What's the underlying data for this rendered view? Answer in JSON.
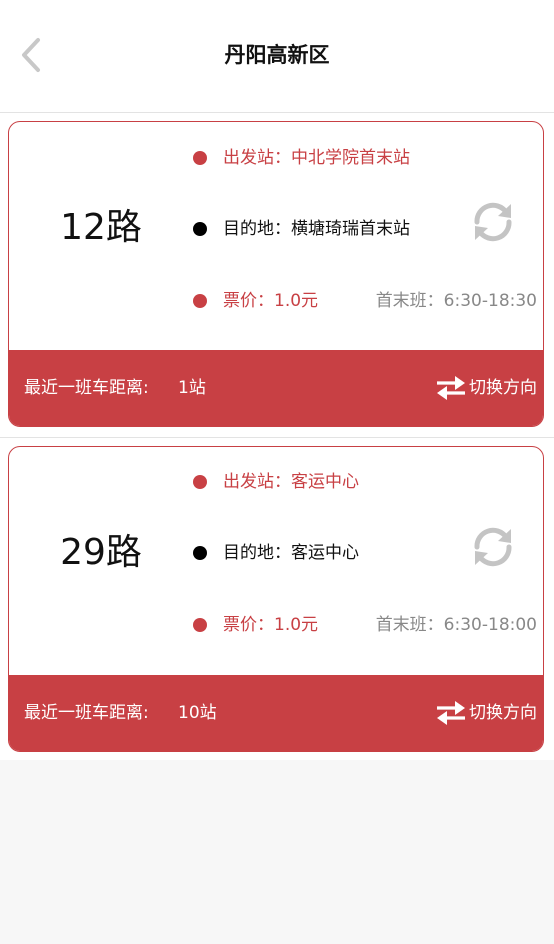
{
  "header": {
    "title": "丹阳高新区",
    "back_icon": "chevron-left-icon"
  },
  "routes": [
    {
      "name": "12路",
      "origin": "出发站：中北学院首末站",
      "destination": "目的地：横塘琦瑞首末站",
      "fare": "票价：1.0元",
      "schedule": "首末班：6:30-18:30",
      "distance_label": "最近一班车距离:",
      "distance_value": "1站",
      "switch_label": "切换方向"
    },
    {
      "name": "29路",
      "origin": "出发站：客运中心",
      "destination": "目的地：客运中心",
      "fare": "票价：1.0元",
      "schedule": "首末班：6:30-18:00",
      "distance_label": "最近一班车距离:",
      "distance_value": "10站",
      "switch_label": "切换方向"
    }
  ],
  "icons": {
    "refresh": "refresh-icon",
    "switch": "switch-direction-icon"
  },
  "colors": {
    "accent": "#c84044",
    "background": "#f7f7f7",
    "muted_text": "#888888"
  }
}
